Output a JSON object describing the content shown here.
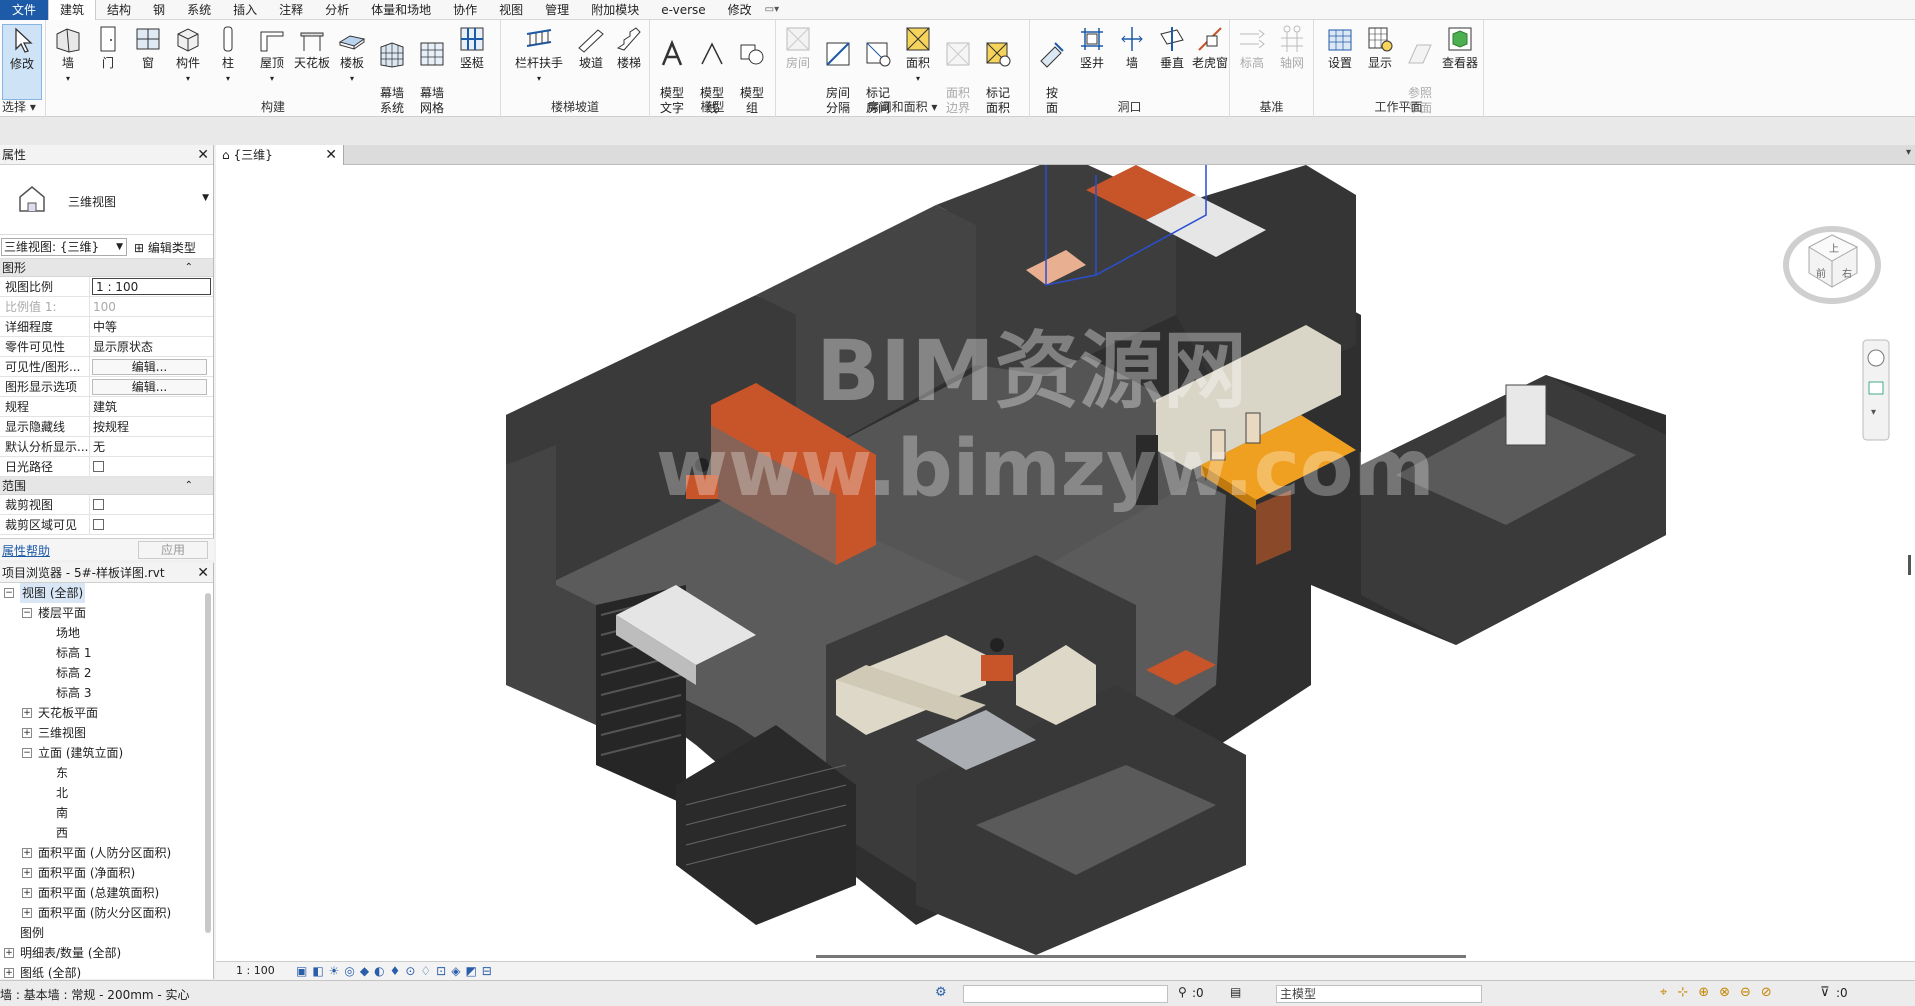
{
  "menubar": {
    "items": [
      "文件",
      "建筑",
      "结构",
      "钢",
      "系统",
      "插入",
      "注释",
      "分析",
      "体量和场地",
      "协作",
      "视图",
      "管理",
      "附加模块",
      "e-verse",
      "修改"
    ],
    "active_index": 1,
    "quick_access": "▭▾"
  },
  "ribbon": {
    "select_panel": {
      "title": "选择",
      "tool": "修改"
    },
    "build_panel": {
      "title": "构建",
      "tools": [
        "墙",
        "门",
        "窗",
        "构件",
        "柱",
        "屋顶",
        "天花板",
        "楼板",
        "幕墙\n系统",
        "幕墙\n网格",
        "竖梃"
      ]
    },
    "circulation_panel": {
      "title": "楼梯坡道",
      "tools": [
        "栏杆扶手",
        "坡道",
        "楼梯"
      ]
    },
    "model_panel": {
      "title": "模型",
      "tools": [
        "模型\n文字",
        "模型\n线",
        "模型\n组"
      ]
    },
    "room_panel": {
      "title": "房间和面积",
      "tools": [
        "房间",
        "房间\n分隔",
        "标记\n房间",
        "面积",
        "面积\n边界",
        "标记\n面积"
      ]
    },
    "opening_panel": {
      "title": "洞口",
      "tools": [
        "按\n面",
        "竖井",
        "墙",
        "垂直",
        "老虎窗"
      ]
    },
    "datum_panel": {
      "title": "基准",
      "tools": [
        "标高",
        "轴网"
      ]
    },
    "workplane_panel": {
      "title": "工作平面",
      "tools": [
        "设置",
        "显示",
        "参照\n平面",
        "查看器"
      ]
    }
  },
  "properties": {
    "title": "属性",
    "type_label": "三维视图",
    "view_selector": "三维视图: {三维}",
    "edit_type": "编辑类型",
    "group_graphics": "图形",
    "rows": [
      {
        "k": "视图比例",
        "v": "1 : 100"
      },
      {
        "k": "比例值 1:",
        "v": "100"
      },
      {
        "k": "详细程度",
        "v": "中等"
      },
      {
        "k": "零件可见性",
        "v": "显示原状态"
      },
      {
        "k": "可见性/图形...",
        "v": "编辑..."
      },
      {
        "k": "图形显示选项",
        "v": "编辑..."
      },
      {
        "k": "规程",
        "v": "建筑"
      },
      {
        "k": "显示隐藏线",
        "v": "按规程"
      },
      {
        "k": "默认分析显示...",
        "v": "无"
      },
      {
        "k": "日光路径",
        "v": ""
      }
    ],
    "group_extents": "范围",
    "extent_rows": [
      {
        "k": "裁剪视图",
        "v": ""
      },
      {
        "k": "裁剪区域可见",
        "v": ""
      }
    ],
    "help": "属性帮助",
    "apply": "应用"
  },
  "browser": {
    "title": "项目浏览器 - 5#-样板详图.rvt",
    "nodes": [
      {
        "label": "视图 (全部)",
        "level": 0,
        "exp": "−"
      },
      {
        "label": "楼层平面",
        "level": 1,
        "exp": "−"
      },
      {
        "label": "场地",
        "level": 2,
        "exp": ""
      },
      {
        "label": "标高 1",
        "level": 2,
        "exp": ""
      },
      {
        "label": "标高 2",
        "level": 2,
        "exp": ""
      },
      {
        "label": "标高 3",
        "level": 2,
        "exp": ""
      },
      {
        "label": "天花板平面",
        "level": 1,
        "exp": "+"
      },
      {
        "label": "三维视图",
        "level": 1,
        "exp": "+"
      },
      {
        "label": "立面 (建筑立面)",
        "level": 1,
        "exp": "−"
      },
      {
        "label": "东",
        "level": 2,
        "exp": ""
      },
      {
        "label": "北",
        "level": 2,
        "exp": ""
      },
      {
        "label": "南",
        "level": 2,
        "exp": ""
      },
      {
        "label": "西",
        "level": 2,
        "exp": ""
      },
      {
        "label": "面积平面 (人防分区面积)",
        "level": 1,
        "exp": "+"
      },
      {
        "label": "面积平面 (净面积)",
        "level": 1,
        "exp": "+"
      },
      {
        "label": "面积平面 (总建筑面积)",
        "level": 1,
        "exp": "+"
      },
      {
        "label": "面积平面 (防火分区面积)",
        "level": 1,
        "exp": "+"
      },
      {
        "label": "图例",
        "level": 0,
        "exp": ""
      },
      {
        "label": "明细表/数量 (全部)",
        "level": 0,
        "exp": "+"
      },
      {
        "label": "图纸 (全部)",
        "level": 0,
        "exp": "+"
      }
    ]
  },
  "view": {
    "tab_label": "{三维}",
    "watermark_1": "BIM资源网",
    "watermark_2": "www.bimzyw.com",
    "viewcube_top": "上",
    "viewcube_front": "前",
    "viewcube_right": "右",
    "scale": "1 : 100"
  },
  "status": {
    "message": "墙 : 基本墙 : 常规 - 200mm - 实心",
    "count1": ":0",
    "model": "主模型",
    "count2": ":0"
  },
  "colors": {
    "file_blue": "#1d5aa8",
    "wall_dark": "#3b3b3b",
    "floor_gray": "#5a5a5a",
    "orange": "#c8552a",
    "table_yellow": "#f0a020"
  }
}
